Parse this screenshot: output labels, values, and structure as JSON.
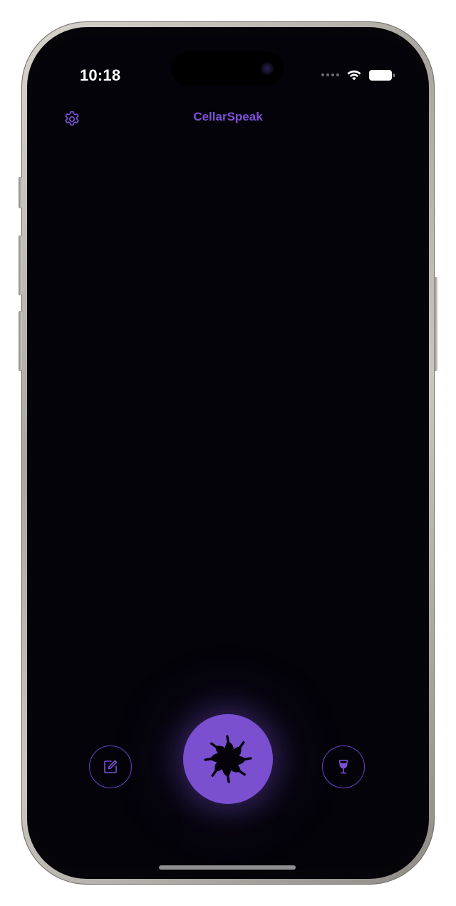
{
  "status_bar": {
    "time": "10:18"
  },
  "header": {
    "title": "CellarSpeak",
    "settings_icon": "gear-icon"
  },
  "bottom_bar": {
    "left_icon": "compose-icon",
    "center_icon": "bottles-pinwheel-icon",
    "right_icon": "wine-glass-icon"
  },
  "colors": {
    "background": "#040309",
    "accent": "#7a4fd0",
    "title": "#7c50d6"
  }
}
